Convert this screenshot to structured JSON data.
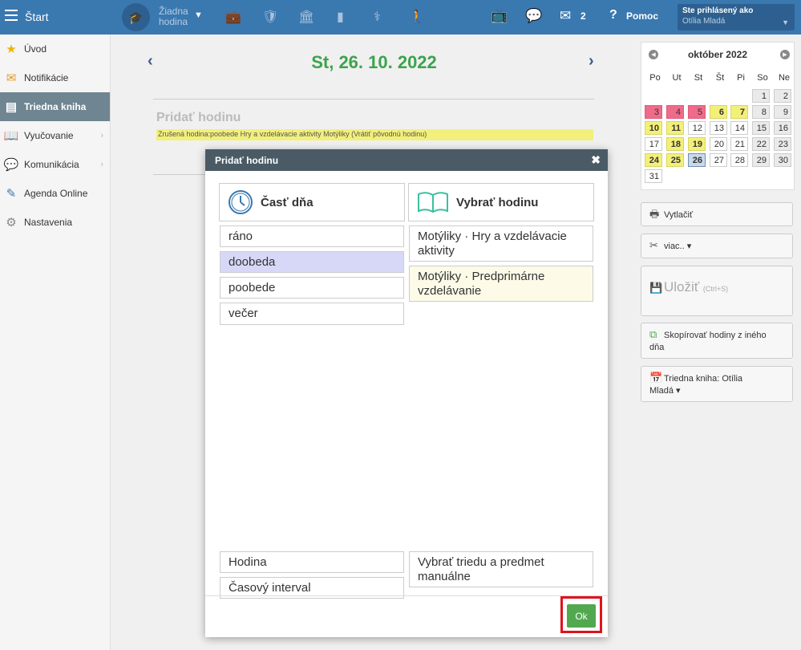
{
  "topbar": {
    "start_label": "Štart",
    "lesson_line1": "Žiadna",
    "lesson_line2": "hodina",
    "message_count": "2",
    "help_label": "Pomoc",
    "user_label": "Ste prihlásený ako",
    "user_name": "Otília Mladá"
  },
  "sidebar": {
    "items": [
      {
        "label": "Úvod",
        "icon": "star-icon"
      },
      {
        "label": "Notifikácie",
        "icon": "envelope-icon"
      },
      {
        "label": "Triedna kniha",
        "icon": "book-icon"
      },
      {
        "label": "Vyučovanie",
        "icon": "open-book-icon"
      },
      {
        "label": "Komunikácia",
        "icon": "chat-icon"
      },
      {
        "label": "Agenda Online",
        "icon": "pen-icon"
      },
      {
        "label": "Nastavenia",
        "icon": "gear-icon"
      }
    ]
  },
  "main": {
    "date_title": "St, 26. 10. 2022",
    "add_lesson_heading": "Pridať hodinu",
    "cancelled_note": "Zrušená hodina:poobede  Hry a vzdelávacie aktivity  Motýliky  (Vrátiť pôvodnú hodinu)"
  },
  "calendar": {
    "month": "október 2022",
    "dow": [
      "Po",
      "Ut",
      "St",
      "Št",
      "Pi",
      "So",
      "Ne"
    ]
  },
  "right_buttons": {
    "print": "Vytlačiť",
    "more": "viac.. ▾",
    "save": "Uložiť",
    "save_shortcut": "(Ctrl+S)",
    "copy_line1": "Skopírovať hodiny z iného",
    "copy_line2": "dňa",
    "classbook_line1": "Triedna kniha: Otília",
    "classbook_line2": "Mladá ▾"
  },
  "modal": {
    "title": "Pridať hodinu",
    "col_left": "Časť dňa",
    "col_right": "Vybrať hodinu",
    "day_parts": [
      "ráno",
      "doobeda",
      "poobede",
      "večer"
    ],
    "lessons": [
      {
        "line1": "Motýliky · Hry a vzdelávacie",
        "line2": "aktivity"
      },
      {
        "line1": "Motýliky · Predprimárne",
        "line2": "vzdelávanie"
      }
    ],
    "bottom_left": [
      "Hodina",
      "Časový interval"
    ],
    "bottom_right_line1": "Vybrať triedu a predmet",
    "bottom_right_line2": "manuálne",
    "ok_label": "Ok"
  },
  "colors": {
    "topbar": "#3a78b0",
    "date_green": "#3aa44c",
    "modal_header": "#4a5b66",
    "ok_green": "#52a84f",
    "highlight_red": "#e0121c"
  }
}
